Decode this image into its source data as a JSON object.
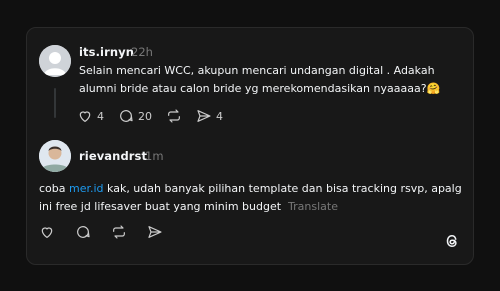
{
  "post": {
    "username": "its.irnyn",
    "time": "22h",
    "text": "Selain mencari WCC, akupun mencari undangan digital . Adakah alumni bride atau calon bride yg merekomendasikan nyaaaaa?🤗",
    "counts": {
      "likes": "4",
      "comments": "20",
      "shares": "4"
    }
  },
  "reply": {
    "username": "rievandrst",
    "time": "1m",
    "text_before": "coba ",
    "link": "mer.id",
    "text_after": " kak, udah banyak pilihan template dan bisa tracking rsvp, apalg ini free jd lifesaver buat yang minim budget",
    "translate": "Translate"
  },
  "colors": {
    "accent_link": "#1d9bf0",
    "muted": "#777777",
    "card": "#181818",
    "background": "#101010"
  },
  "icons": [
    "heart-icon",
    "comment-icon",
    "repost-icon",
    "share-icon",
    "threads-logo-icon"
  ]
}
